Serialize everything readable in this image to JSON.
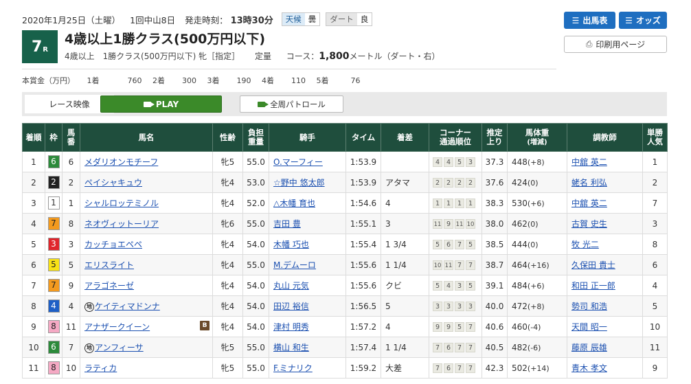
{
  "header": {
    "date": "2020年1月25日（土曜）",
    "meeting": "1回中山8日",
    "start_label": "発走時刻：",
    "start_time": "13時30分",
    "weather_label": "天候",
    "weather": "曇",
    "track_label": "ダート",
    "track_condition": "良"
  },
  "race": {
    "number": "7",
    "number_suffix": "R",
    "title": "4歳以上1勝クラス(500万円以下)",
    "conditions": "4歳以上　1勝クラス(500万円以下) 牝［指定］",
    "weight_rule": "定量",
    "course_label": "コース：",
    "distance": "1,800",
    "distance_unit": "メートル（ダート・右）"
  },
  "prize": {
    "label": "本賞金（万円）",
    "items": [
      {
        "place": "1着",
        "amount": "760"
      },
      {
        "place": "2着",
        "amount": "300"
      },
      {
        "place": "3着",
        "amount": "190"
      },
      {
        "place": "4着",
        "amount": "110"
      },
      {
        "place": "5着",
        "amount": "76"
      }
    ]
  },
  "buttons": {
    "entries": "出馬表",
    "odds": "オッズ",
    "print": "印刷用ページ"
  },
  "video": {
    "label": "レース映像",
    "play": "PLAY",
    "patrol": "全周パトロール"
  },
  "colors": {
    "header_bg": "#1f4e3d",
    "race_badge": "#17614a",
    "primary_button": "#1e6ec0",
    "play_button": "#3b8a29",
    "link": "#1a4fb0"
  },
  "table": {
    "headers": [
      "着順",
      "枠",
      "馬番",
      "馬名",
      "性齢",
      "負担重量",
      "騎手",
      "タイム",
      "着差",
      "コーナー通過順位",
      "推定上り",
      "馬体重(増減)",
      "調教師",
      "単勝人気"
    ],
    "rows": [
      {
        "pos": "1",
        "waku": "6",
        "num": "6",
        "horse": "メダリオンモチーフ",
        "mark": "",
        "b": "",
        "sex": "牝5",
        "wt": "55.0",
        "jockey": "O.マーフィー",
        "time": "1:53.9",
        "margin": "",
        "corners": [
          "4",
          "4",
          "5",
          "3"
        ],
        "last3f": "37.3",
        "bw": "448",
        "bwd": "(+8)",
        "trainer": "中舘 英二",
        "pop": "1"
      },
      {
        "pos": "2",
        "waku": "2",
        "num": "2",
        "horse": "ペイシャキュウ",
        "mark": "",
        "b": "",
        "sex": "牝4",
        "wt": "53.0",
        "jockey": "☆野中 悠太郎",
        "time": "1:53.9",
        "margin": "アタマ",
        "corners": [
          "2",
          "2",
          "2",
          "2"
        ],
        "last3f": "37.6",
        "bw": "424",
        "bwd": "(0)",
        "trainer": "蛯名 利弘",
        "pop": "2"
      },
      {
        "pos": "3",
        "waku": "1",
        "num": "1",
        "horse": "シャルロッテミノル",
        "mark": "",
        "b": "",
        "sex": "牝4",
        "wt": "52.0",
        "jockey": "△木幡 育也",
        "time": "1:54.6",
        "margin": "4",
        "corners": [
          "1",
          "1",
          "1",
          "1"
        ],
        "last3f": "38.3",
        "bw": "530",
        "bwd": "(+6)",
        "trainer": "中舘 英二",
        "pop": "7"
      },
      {
        "pos": "4",
        "waku": "7",
        "num": "8",
        "horse": "ネオヴィットーリア",
        "mark": "",
        "b": "",
        "sex": "牝6",
        "wt": "55.0",
        "jockey": "吉田 豊",
        "time": "1:55.1",
        "margin": "3",
        "corners": [
          "11",
          "9",
          "11",
          "10"
        ],
        "last3f": "38.0",
        "bw": "462",
        "bwd": "(0)",
        "trainer": "古賀 史生",
        "pop": "3"
      },
      {
        "pos": "5",
        "waku": "3",
        "num": "3",
        "horse": "カッチョエペペ",
        "mark": "",
        "b": "",
        "sex": "牝4",
        "wt": "54.0",
        "jockey": "木幡 巧也",
        "time": "1:55.4",
        "margin": "1 3/4",
        "corners": [
          "5",
          "6",
          "7",
          "5"
        ],
        "last3f": "38.5",
        "bw": "444",
        "bwd": "(0)",
        "trainer": "牧 光二",
        "pop": "8"
      },
      {
        "pos": "6",
        "waku": "5",
        "num": "5",
        "horse": "エリスライト",
        "mark": "",
        "b": "",
        "sex": "牝4",
        "wt": "55.0",
        "jockey": "M.デムーロ",
        "time": "1:55.6",
        "margin": "1 1/4",
        "corners": [
          "10",
          "11",
          "7",
          "7"
        ],
        "last3f": "38.7",
        "bw": "464",
        "bwd": "(+16)",
        "trainer": "久保田 貴士",
        "pop": "6"
      },
      {
        "pos": "7",
        "waku": "7",
        "num": "9",
        "horse": "アラゴネーゼ",
        "mark": "",
        "b": "",
        "sex": "牝4",
        "wt": "54.0",
        "jockey": "丸山 元気",
        "time": "1:55.6",
        "margin": "クビ",
        "corners": [
          "5",
          "4",
          "3",
          "5"
        ],
        "last3f": "39.1",
        "bw": "484",
        "bwd": "(+6)",
        "trainer": "和田 正一郎",
        "pop": "4"
      },
      {
        "pos": "8",
        "waku": "4",
        "num": "4",
        "horse": "ケイティマドンナ",
        "mark": "地",
        "b": "",
        "sex": "牝4",
        "wt": "54.0",
        "jockey": "田辺 裕信",
        "time": "1:56.5",
        "margin": "5",
        "corners": [
          "3",
          "3",
          "3",
          "3"
        ],
        "last3f": "40.0",
        "bw": "472",
        "bwd": "(+8)",
        "trainer": "勢司 和浩",
        "pop": "5"
      },
      {
        "pos": "9",
        "waku": "8",
        "num": "11",
        "horse": "アナザークイーン",
        "mark": "",
        "b": "B",
        "sex": "牝4",
        "wt": "54.0",
        "jockey": "津村 明秀",
        "time": "1:57.2",
        "margin": "4",
        "corners": [
          "9",
          "9",
          "5",
          "7"
        ],
        "last3f": "40.6",
        "bw": "460",
        "bwd": "(-4)",
        "trainer": "天間 昭一",
        "pop": "10"
      },
      {
        "pos": "10",
        "waku": "6",
        "num": "7",
        "horse": "アンフィーサ",
        "mark": "地",
        "b": "",
        "sex": "牝5",
        "wt": "55.0",
        "jockey": "横山 和生",
        "time": "1:57.4",
        "margin": "1 1/4",
        "corners": [
          "7",
          "6",
          "7",
          "7"
        ],
        "last3f": "40.5",
        "bw": "482",
        "bwd": "(-6)",
        "trainer": "藤原 辰雄",
        "pop": "11"
      },
      {
        "pos": "11",
        "waku": "8",
        "num": "10",
        "horse": "ラティカ",
        "mark": "",
        "b": "",
        "sex": "牝5",
        "wt": "55.0",
        "jockey": "F.ミナリク",
        "time": "1:59.2",
        "margin": "大差",
        "corners": [
          "7",
          "6",
          "7",
          "7"
        ],
        "last3f": "42.3",
        "bw": "502",
        "bwd": "(+14)",
        "trainer": "青木 孝文",
        "pop": "9"
      }
    ]
  }
}
